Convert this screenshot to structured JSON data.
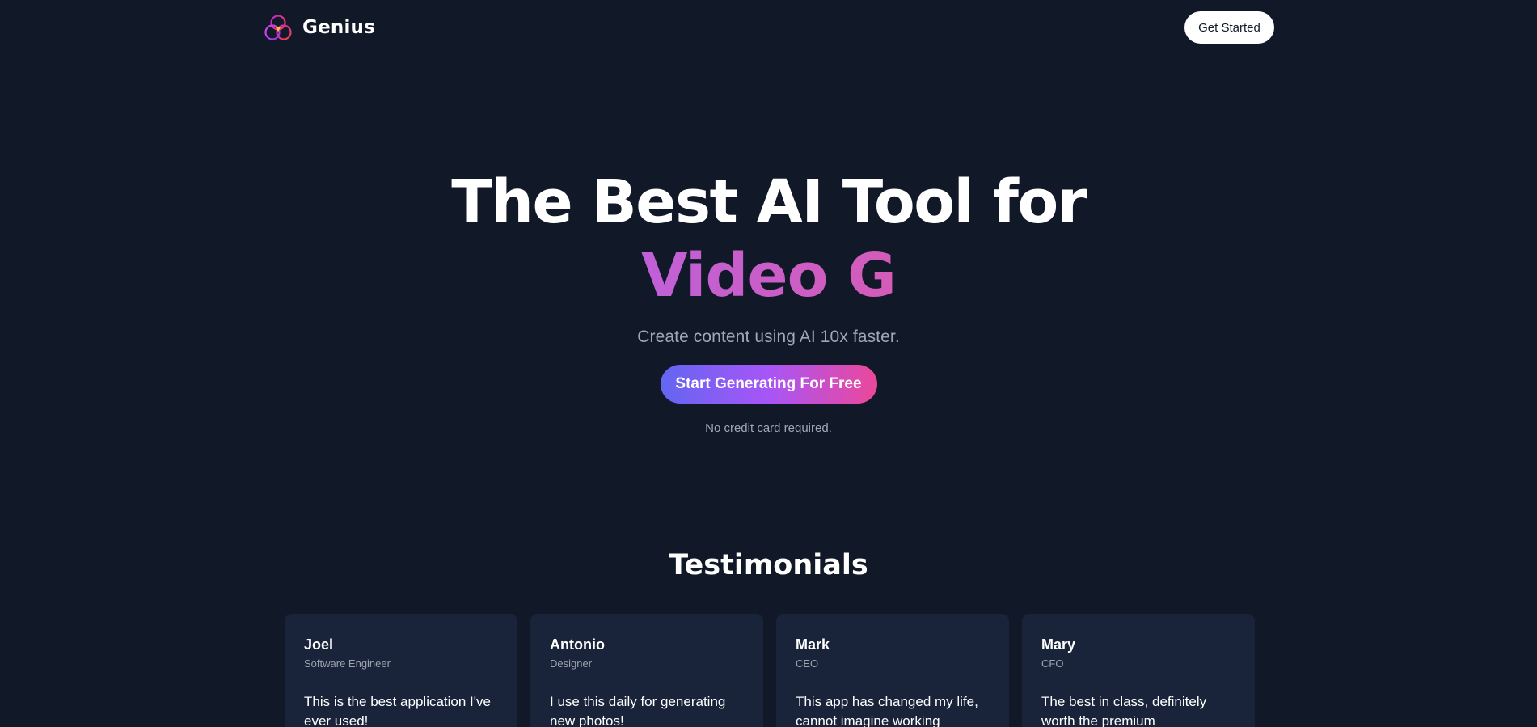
{
  "navbar": {
    "brand_name": "Genius",
    "logo_icon": "triple-ring-logo-icon",
    "cta_label": "Get Started"
  },
  "hero": {
    "title": "The Best AI Tool for",
    "typed_text": "Video G",
    "subtitle": "Create content using AI 10x faster.",
    "cta_label": "Start Generating For Free",
    "note": "No credit card required."
  },
  "testimonials": {
    "title": "Testimonials",
    "items": [
      {
        "name": "Joel",
        "role": "Software Engineer",
        "quote": "This is the best application I've ever used!"
      },
      {
        "name": "Antonio",
        "role": "Designer",
        "quote": "I use this daily for generating new photos!"
      },
      {
        "name": "Mark",
        "role": "CEO",
        "quote": "This app has changed my life, cannot imagine working"
      },
      {
        "name": "Mary",
        "role": "CFO",
        "quote": "The best in class, definitely worth the premium"
      }
    ]
  },
  "colors": {
    "background": "#111827",
    "card_background": "#192339",
    "accent_gradient_start": "#6366f1",
    "accent_gradient_end": "#ec4899",
    "typed_text_color": "#c75fcf"
  }
}
